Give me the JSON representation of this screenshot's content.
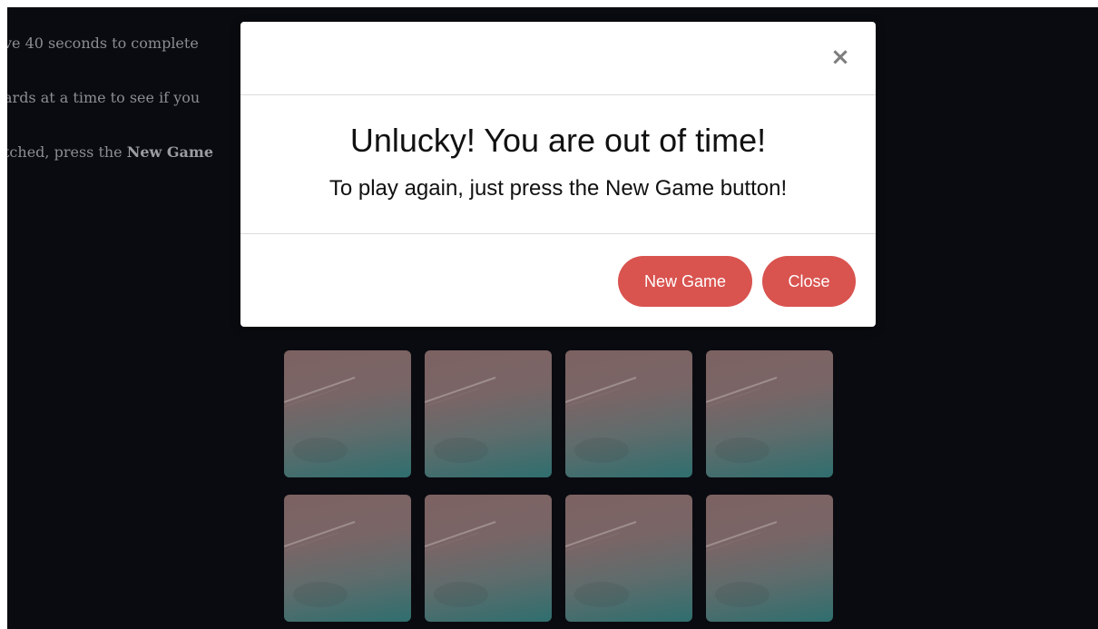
{
  "instructions": {
    "line1": "ve 40 seconds to complete",
    "line2": "ards at a time to see if you",
    "line3_prefix": "tched, press the ",
    "line3_bold": "New Game"
  },
  "modal": {
    "close_glyph": "×",
    "title": "Unlucky! You are out of time!",
    "message": "To play again, just press the New Game button!",
    "new_game_label": "New Game",
    "close_label": "Close",
    "button_color": "#d9534f"
  },
  "cards": [
    {
      "state": "face-down"
    },
    {
      "state": "face-down"
    },
    {
      "state": "face-down"
    },
    {
      "state": "face-down"
    },
    {
      "state": "face-down"
    },
    {
      "state": "face-down"
    },
    {
      "state": "face-down"
    },
    {
      "state": "face-down"
    }
  ],
  "colors": {
    "background": "#0a0b10",
    "card_top": "#7d6262",
    "card_bottom": "#2f6e6e"
  }
}
